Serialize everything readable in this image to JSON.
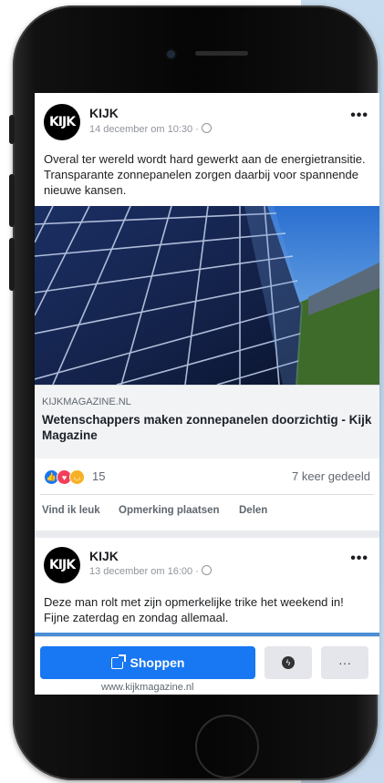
{
  "colors": {
    "accent": "#1877f2",
    "like": "#1877f2",
    "love": "#f33e58",
    "haha": "#f7b125"
  },
  "post1": {
    "page_name": "KIJK",
    "date": "14 december om 10:30 · ",
    "text": "Overal ter wereld wordt hard gewerkt aan de energietransitie. Transparante zonnepanelen zorgen daarbij voor spannende nieuwe kansen.",
    "link_domain": "KIJKMAGAZINE.NL",
    "link_title": "Wetenschappers maken zonnepanelen doorzichtig - Kijk Magazine",
    "reaction_count": "15",
    "shares": "7 keer gedeeld",
    "actions": {
      "like": "Vind ik leuk",
      "comment": "Opmerking plaatsen",
      "share": "Delen"
    }
  },
  "post2": {
    "page_name": "KIJK",
    "date": "13 december om 16:00 · ",
    "text": "Deze man rolt met zijn opmerkelijke trike het weekend in! Fijne zaterdag en zondag allemaal."
  },
  "avatar_text": "KIJK",
  "more_label": "•••",
  "bottom": {
    "shop_label": "Shoppen",
    "url": "www.kijkmagazine.nl",
    "more_label": "···"
  },
  "icons": [
    "globe-icon",
    "like-reaction-icon",
    "love-reaction-icon",
    "haha-reaction-icon",
    "external-link-icon",
    "messenger-icon",
    "more-icon"
  ]
}
